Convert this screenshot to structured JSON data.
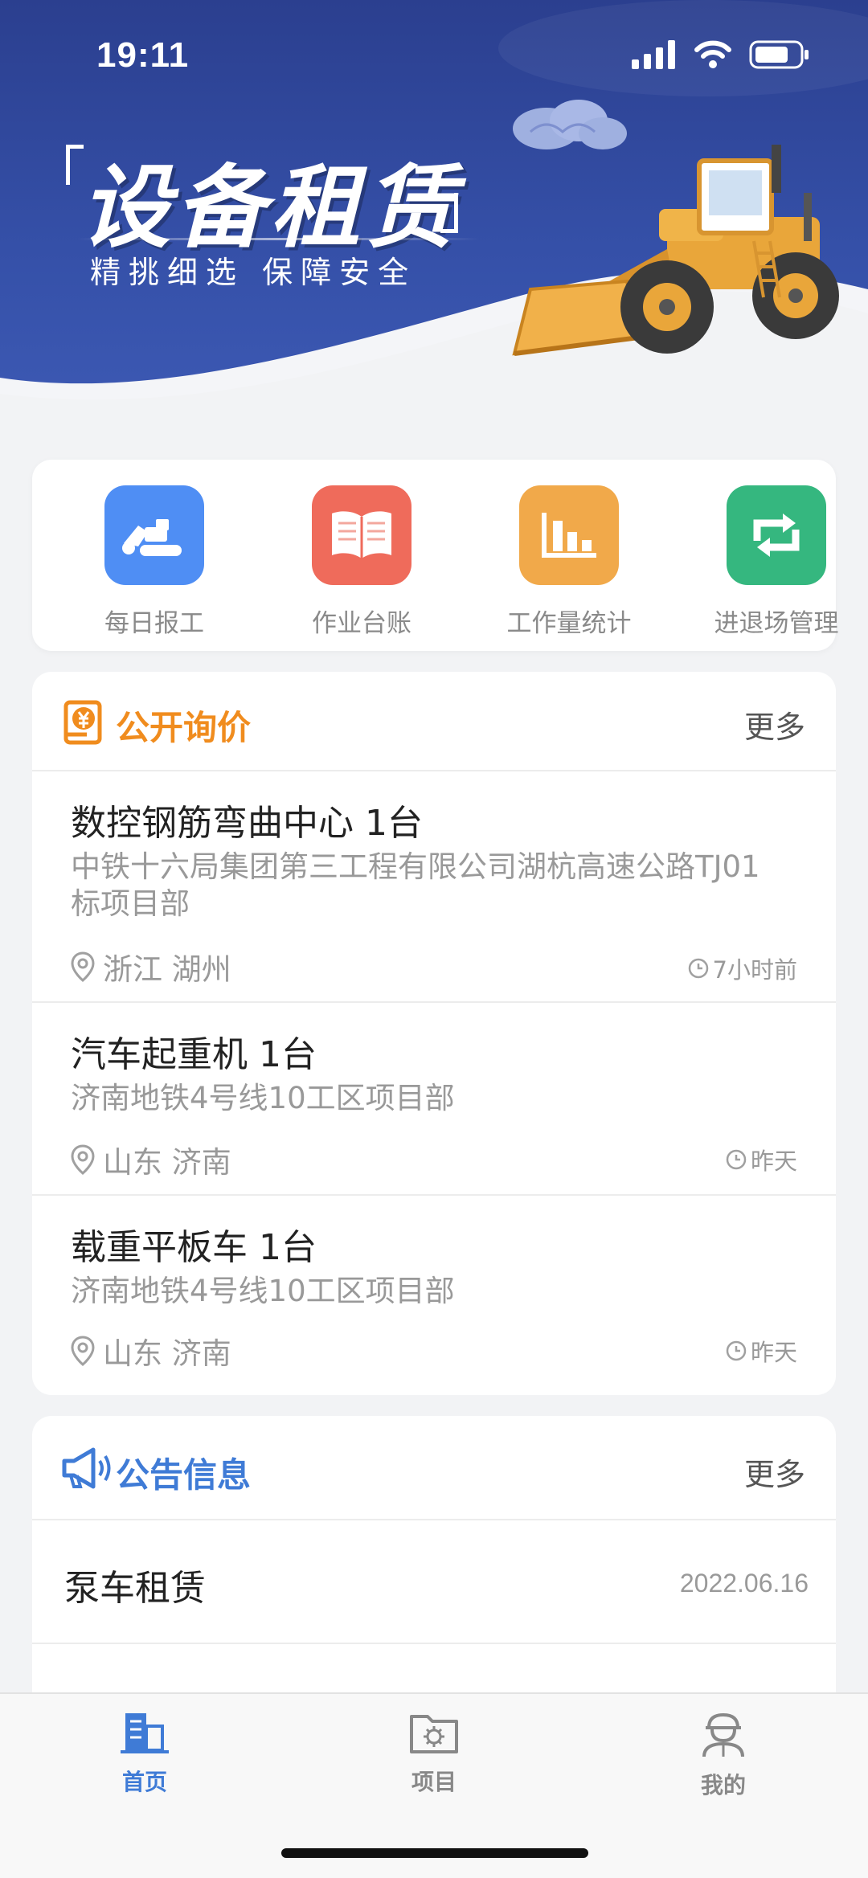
{
  "status_bar": {
    "time": "19:11"
  },
  "banner": {
    "title": "设备租赁",
    "subtitle": "精挑细选  保障安全"
  },
  "quick_actions": [
    {
      "label": "每日报工",
      "icon": "excavator-icon",
      "color": "#4f8ef4"
    },
    {
      "label": "作业台账",
      "icon": "open-book-icon",
      "color": "#ef6b5b"
    },
    {
      "label": "工作量统计",
      "icon": "bar-chart-icon",
      "color": "#f1a94a"
    },
    {
      "label": "进退场管理",
      "icon": "swap-arrows-icon",
      "color": "#35b77f"
    }
  ],
  "inquiry": {
    "title": "公开询价",
    "more": "更多",
    "accent": "#f08c1e",
    "items": [
      {
        "title": "数控钢筋弯曲中心  1台",
        "org": "中铁十六局集团第三工程有限公司湖杭高速公路TJ01标项目部",
        "location": "浙江  湖州",
        "time": "7小时前"
      },
      {
        "title": "汽车起重机  1台",
        "org": "济南地铁4号线10工区项目部",
        "location": "山东  济南",
        "time": "昨天"
      },
      {
        "title": "载重平板车  1台",
        "org": "济南地铁4号线10工区项目部",
        "location": "山东  济南",
        "time": "昨天"
      }
    ]
  },
  "notice": {
    "title": "公告信息",
    "more": "更多",
    "accent": "#3f7bd6",
    "items": [
      {
        "title": "泵车租赁",
        "date": "2022.06.16"
      }
    ]
  },
  "tabs": [
    {
      "label": "首页",
      "icon": "building-icon",
      "active": true
    },
    {
      "label": "项目",
      "icon": "folder-gear-icon",
      "active": false
    },
    {
      "label": "我的",
      "icon": "worker-icon",
      "active": false
    }
  ]
}
